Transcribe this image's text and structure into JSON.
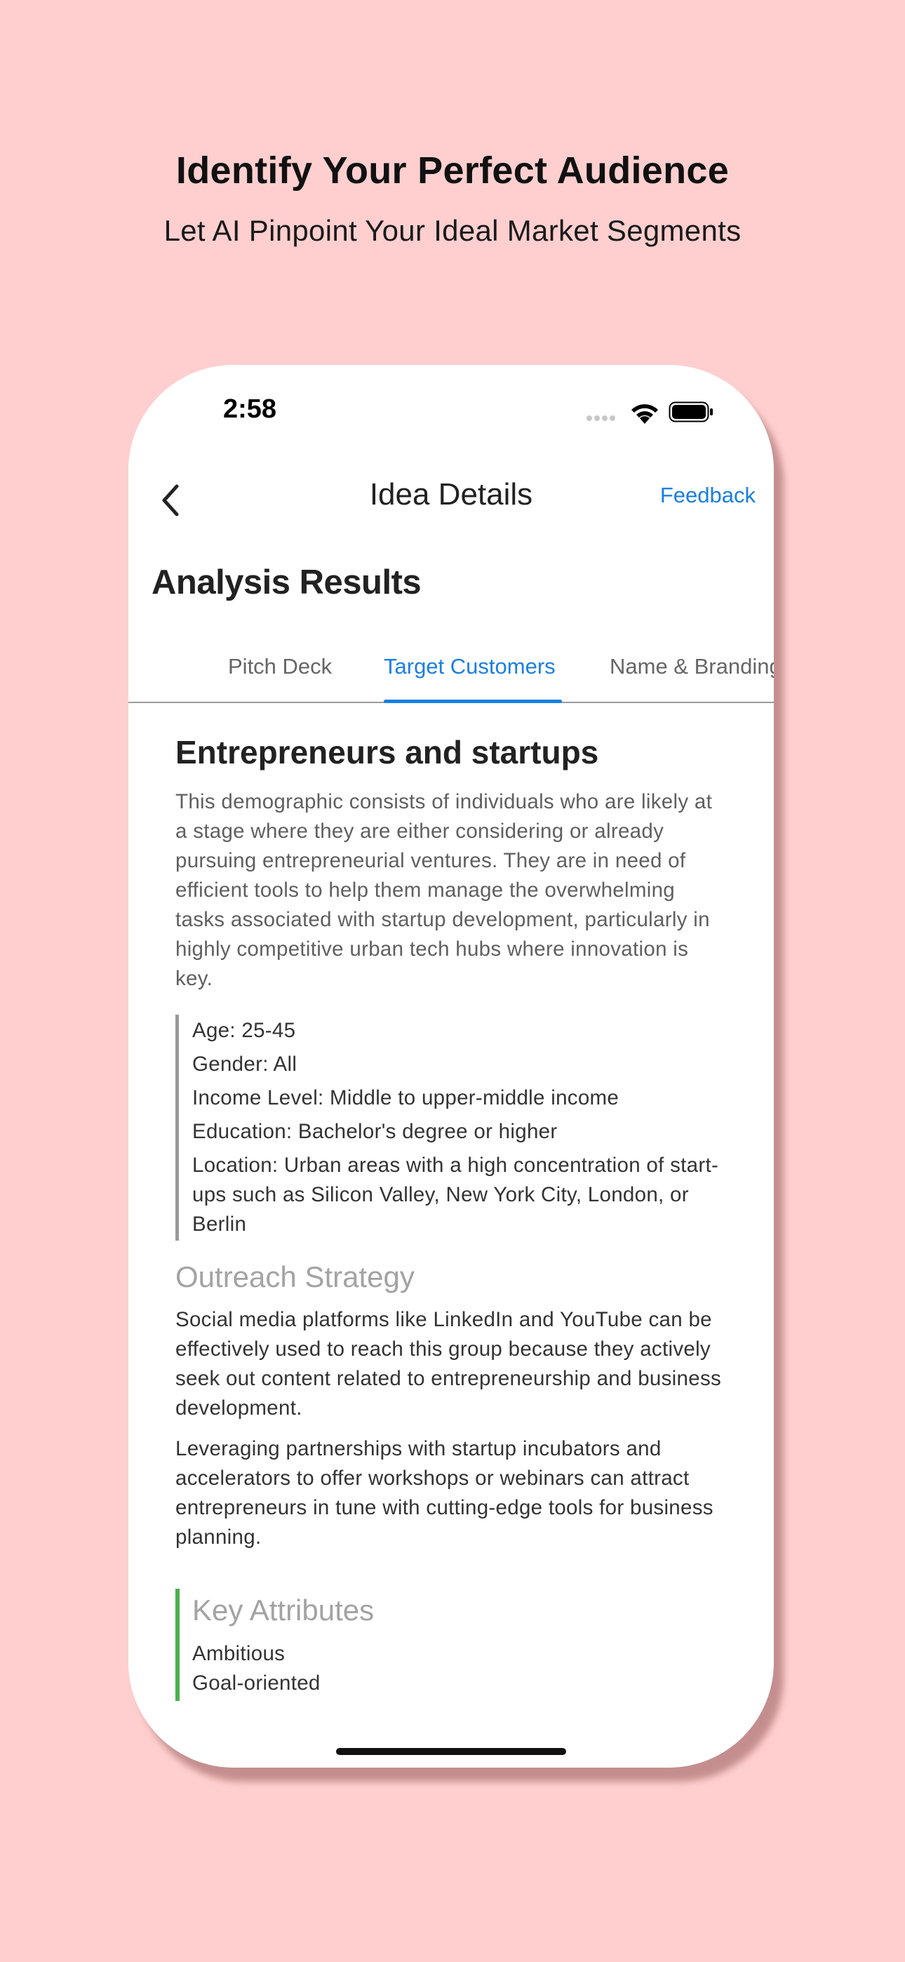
{
  "promo": {
    "title": "Identify Your Perfect Audience",
    "subtitle": "Let AI Pinpoint Your Ideal Market Segments"
  },
  "status_bar": {
    "time": "2:58",
    "icons": [
      "signal-dots-icon",
      "wifi-icon",
      "battery-icon"
    ]
  },
  "nav": {
    "back_icon": "chevron-left-icon",
    "title": "Idea Details",
    "feedback": "Feedback"
  },
  "page_heading": "Analysis Results",
  "tabs": [
    {
      "label": "Pitch Deck",
      "active": false
    },
    {
      "label": "Target Customers",
      "active": true
    },
    {
      "label": "Name & Branding",
      "active": false
    }
  ],
  "segment": {
    "title": "Entrepreneurs and startups",
    "description": "This demographic consists of individuals who are likely at a stage where they are either considering or already pursuing entrepreneurial ventures. They are in need of efficient tools to help them manage the overwhelming tasks associated with startup development, particularly in highly competitive urban tech hubs where innovation is key.",
    "demographics": [
      "Age: 25-45",
      "Gender: All",
      "Income Level: Middle to upper-middle income",
      "Education: Bachelor's degree or higher",
      "Location: Urban areas with a high concentration of start-ups such as Silicon Valley, New York City, London, or Berlin"
    ],
    "outreach_heading": "Outreach Strategy",
    "outreach": [
      "Social media platforms like LinkedIn and YouTube can be effectively used to reach this group because they actively seek out content related to entrepreneurship and business development.",
      "Leveraging partnerships with startup incubators and accelerators to offer workshops or webinars can attract entrepreneurs in tune with cutting-edge tools for business planning."
    ],
    "key_attributes_heading": "Key Attributes",
    "key_attributes": [
      "Ambitious",
      "Goal-oriented"
    ]
  },
  "colors": {
    "background": "#ffcfcf",
    "accent": "#1a7fe0",
    "key_attributes_bar": "#4caf50",
    "demographics_bar": "#9a9a9a"
  }
}
